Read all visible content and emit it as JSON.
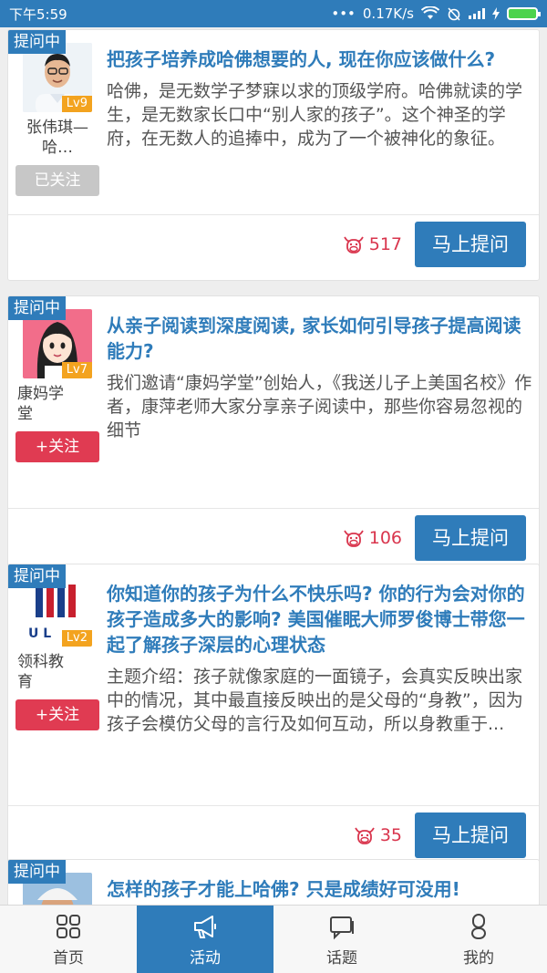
{
  "status_bar": {
    "time": "下午5:59",
    "dots": "•••",
    "network_speed": "0.17K/s",
    "battery_color": "#4cd34c"
  },
  "colors": {
    "primary": "#2f7cba",
    "follow": "#e03b52",
    "followed": "#c7c7c7",
    "level": "#f3a31f",
    "hot": "#d9354d"
  },
  "cards": [
    {
      "tag": "提问中",
      "author": {
        "name": "张伟琪—哈…",
        "level": "Lv9",
        "follow_label": "已关注"
      },
      "title": "把孩子培养成哈佛想要的人, 现在你应该做什么?",
      "desc": "哈佛，是无数学子梦寐以求的顶级学府。哈佛就读的学生，是无数家长口中“别人家的孩子”。这个神圣的学府，在无数人的追捧中，成为了一个被神化的象征。",
      "hot_count": "517",
      "ask_label": "马上提问"
    },
    {
      "tag": "提问中",
      "author": {
        "name": "康妈学堂",
        "level": "Lv7",
        "follow_label": "+关注"
      },
      "title": "从亲子阅读到深度阅读, 家长如何引导孩子提高阅读能力?",
      "desc": "我们邀请“康妈学堂”创始人，《我送儿子上美国名校》作者，康萍老师大家分享亲子阅读中，那些你容易忽视的细节",
      "hot_count": "106",
      "ask_label": "马上提问"
    },
    {
      "tag": "提问中",
      "author": {
        "name": "领科教育",
        "level": "Lv2",
        "follow_label": "+关注"
      },
      "title": "你知道你的孩子为什么不快乐吗? 你的行为会对你的孩子造成多大的影响? 美国催眠大师罗俊博士带您一起了解孩子深层的心理状态",
      "desc": "主题介绍：孩子就像家庭的一面镜子，会真实反映出家中的情况，其中最直接反映出的是父母的“身教”，因为孩子会模仿父母的言行及如何互动，所以身教重于...",
      "hot_count": "35",
      "ask_label": "马上提问"
    },
    {
      "tag": "提问中",
      "title": "怎样的孩子才能上哈佛? 只是成绩好可没用!"
    }
  ],
  "bottom_nav": [
    {
      "label": "首页",
      "icon": "grid-icon"
    },
    {
      "label": "活动",
      "icon": "megaphone-icon"
    },
    {
      "label": "话题",
      "icon": "chat-icon"
    },
    {
      "label": "我的",
      "icon": "person-icon"
    }
  ]
}
